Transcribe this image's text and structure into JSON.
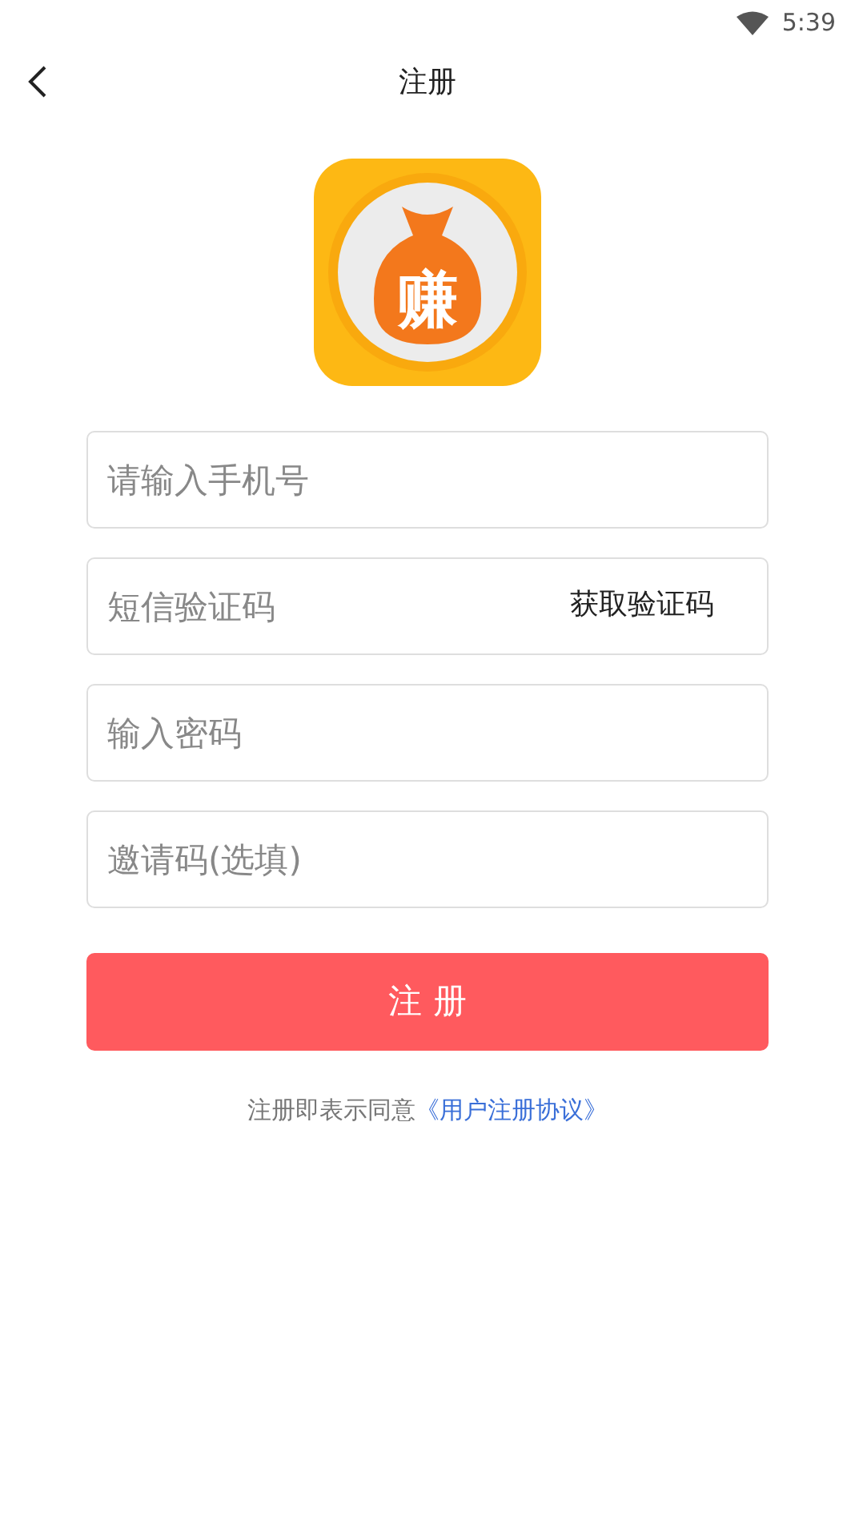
{
  "status_bar": {
    "time": "5:39"
  },
  "header": {
    "title": "注册"
  },
  "logo": {
    "glyph": "赚"
  },
  "fields": [
    {
      "placeholder": "请输入手机号",
      "kind": "text"
    },
    {
      "placeholder": "短信验证码",
      "kind": "code",
      "action": "获取验证码"
    },
    {
      "placeholder": "输入密码",
      "kind": "password"
    },
    {
      "placeholder": "邀请码(选填)",
      "kind": "text"
    }
  ],
  "submit": {
    "label": "注 册"
  },
  "agreement": {
    "text": "注册即表示同意",
    "link": "《用户注册协议》"
  }
}
